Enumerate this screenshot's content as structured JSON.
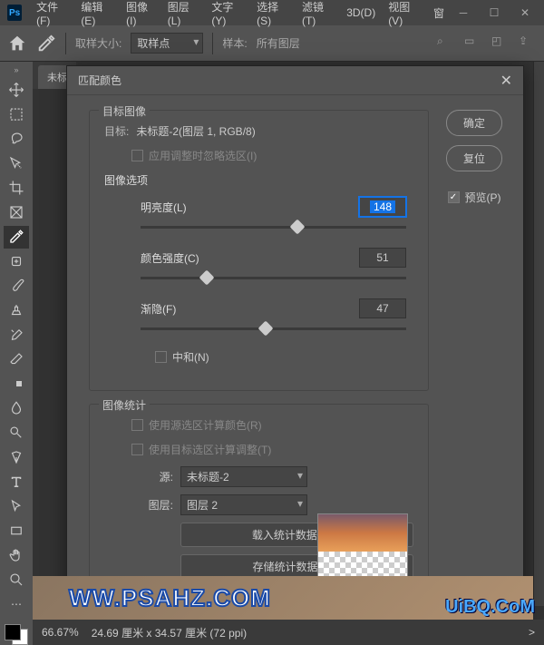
{
  "menu": {
    "file": "文件(F)",
    "edit": "编辑(E)",
    "image": "图像(I)",
    "layer": "图层(L)",
    "type": "文字(Y)",
    "select": "选择(S)",
    "filter": "滤镜(T)",
    "threed": "3D(D)",
    "view": "视图(V)",
    "more": "窗"
  },
  "options": {
    "sample_size_lbl": "取样大小:",
    "sample_size_val": "取样点",
    "sample_lbl": "样本:",
    "sample_val": "所有图层"
  },
  "tab": {
    "name": "未标"
  },
  "dialog": {
    "title": "匹配颜色",
    "ok": "确定",
    "reset": "复位",
    "preview": "预览(P)",
    "target_section": "目标图像",
    "target_lbl": "目标:",
    "target_val": "未标题-2(图层 1, RGB/8)",
    "ignore_sel": "应用调整时忽略选区(I)",
    "options_section": "图像选项",
    "luminance": "明亮度(L)",
    "luminance_val": "148",
    "intensity": "颜色强度(C)",
    "intensity_val": "51",
    "fade": "渐隐(F)",
    "fade_val": "47",
    "neutralize": "中和(N)",
    "stats_section": "图像统计",
    "use_src_sel": "使用源选区计算颜色(R)",
    "use_tgt_sel": "使用目标选区计算调整(T)",
    "source_lbl": "源:",
    "source_val": "未标题-2",
    "layer_lbl": "图层:",
    "layer_val": "图层 2",
    "load_stats": "载入统计数据(O)...",
    "save_stats": "存储统计数据(V)..."
  },
  "watermark": "WW.PSAHZ.COM",
  "status": {
    "zoom": "66.67%",
    "dims": "24.69 厘米 x 34.57 厘米 (72 ppi)",
    "caret": ">"
  },
  "uibq": "UiBQ.CoM"
}
